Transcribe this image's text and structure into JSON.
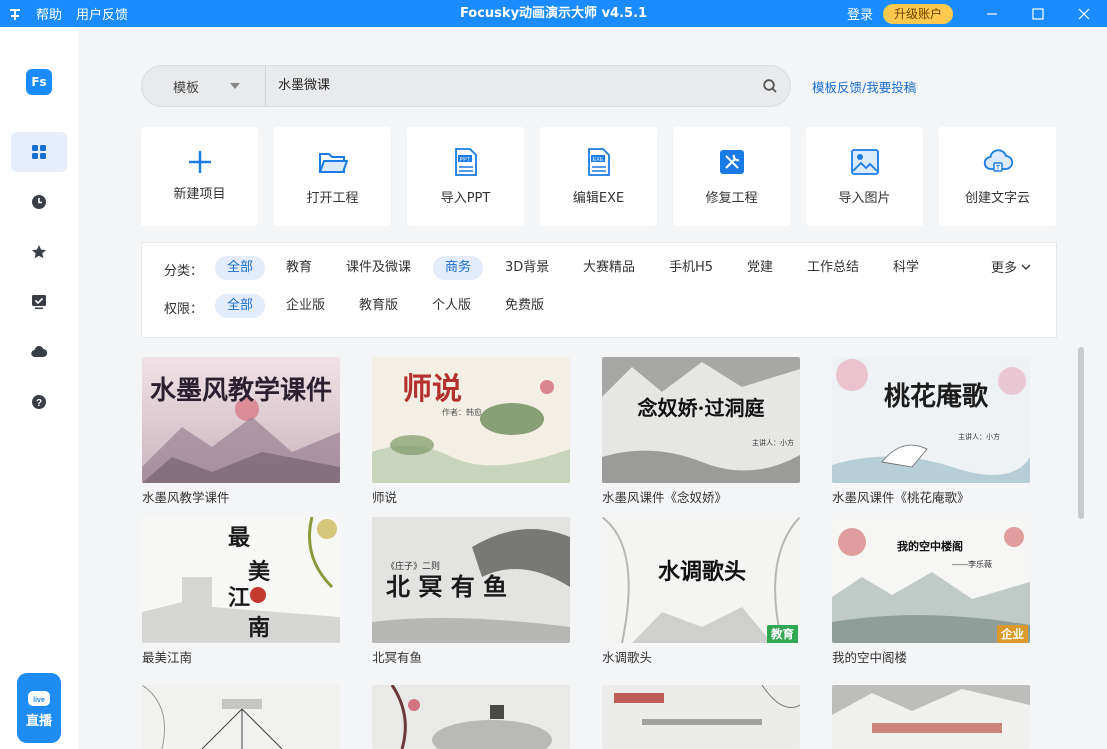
{
  "titlebar": {
    "menu_help": "帮助",
    "menu_feedback": "用户反馈",
    "title": "Focusky动画演示大师 v4.5.1",
    "login": "登录",
    "upgrade": "升级账户"
  },
  "sidebar": {
    "logo": "Fs",
    "live_label": "直播",
    "live_badge": "live"
  },
  "search": {
    "scope": "模板",
    "query": "水墨微课",
    "feedback_link": "模板反馈/我要投稿"
  },
  "actions": [
    {
      "label": "新建项目",
      "icon": "plus-icon"
    },
    {
      "label": "打开工程",
      "icon": "folder-open-icon"
    },
    {
      "label": "导入PPT",
      "icon": "ppt-file-icon"
    },
    {
      "label": "编辑EXE",
      "icon": "exe-file-icon"
    },
    {
      "label": "修复工程",
      "icon": "repair-tools-icon"
    },
    {
      "label": "导入图片",
      "icon": "image-icon"
    },
    {
      "label": "创建文字云",
      "icon": "cloud-text-icon"
    }
  ],
  "filters": {
    "category_label": "分类：",
    "categories": [
      "全部",
      "教育",
      "课件及微课",
      "商务",
      "3D背景",
      "大赛精品",
      "手机H5",
      "党建",
      "工作总结",
      "科学"
    ],
    "more": "更多",
    "permission_label": "权限：",
    "permissions": [
      "全部",
      "企业版",
      "教育版",
      "个人版",
      "免费版"
    ]
  },
  "templates": [
    {
      "title": "水墨风教学课件",
      "art_text": "水墨风教学课件"
    },
    {
      "title": "师说",
      "art_text": "师说",
      "art_sub": "作者：韩愈"
    },
    {
      "title": "水墨风课件《念奴娇》",
      "art_text": "念奴娇·过洞庭",
      "art_sub": "主讲人：小方"
    },
    {
      "title": "水墨风课件《桃花庵歌》",
      "art_text": "桃花庵歌",
      "art_sub": "主讲人：小方"
    },
    {
      "title": "最美江南",
      "art_text": "最美江南"
    },
    {
      "title": "北冥有鱼",
      "art_text": "北 冥 有 鱼",
      "art_sub": "《庄子》二则"
    },
    {
      "title": "水调歌头",
      "art_text": "水调歌头",
      "badge": "教育"
    },
    {
      "title": "我的空中阁楼",
      "art_text": "我的空中楼阁",
      "art_sub": "——李乐薇",
      "badge": "企业"
    }
  ],
  "colors": {
    "brand": "#1a8cff",
    "upgrade": "#ffc94d",
    "active_chip_text": "#1a6fd0",
    "badge_edu": "#33a852",
    "badge_ent": "#d99a2b"
  }
}
